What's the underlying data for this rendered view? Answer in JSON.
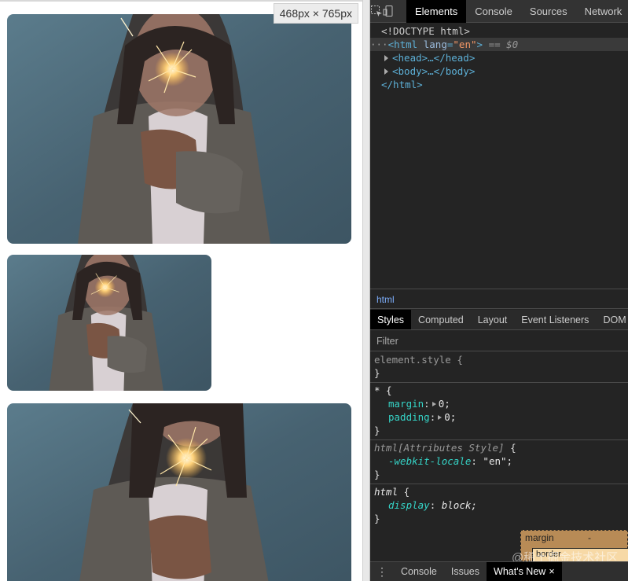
{
  "viewport": {
    "size_badge": "468px × 765px"
  },
  "devtools": {
    "tabs": [
      "Elements",
      "Console",
      "Sources",
      "Network"
    ],
    "dom": {
      "doctype": "<!DOCTYPE html>",
      "html_open_tag": "<html",
      "html_attr_name": "lang",
      "html_attr_value": "\"en\"",
      "html_close_bracket": ">",
      "selected_marker": "== $0",
      "head_node": "<head>…</head>",
      "body_node": "<body>…</body>",
      "html_close": "</html>",
      "dots": "···"
    },
    "breadcrumb": "html",
    "subtabs": [
      "Styles",
      "Computed",
      "Layout",
      "Event Listeners",
      "DOM"
    ],
    "filter_placeholder": "Filter",
    "rules": {
      "element_style": {
        "selector": "element.style {",
        "close": "}"
      },
      "universal": {
        "selector": "* {",
        "margin_prop": "margin",
        "margin_val": "0;",
        "padding_prop": "padding",
        "padding_val": "0;",
        "close": "}"
      },
      "html_attr": {
        "selector": "html[Attributes Style]",
        "brace": "{",
        "prop": "-webkit-locale",
        "val": "\"en\";",
        "close": "}"
      },
      "html": {
        "selector": "html",
        "brace": "{",
        "prop": "display",
        "val": "block;",
        "close": "}"
      }
    },
    "box_model": {
      "margin_label": "margin",
      "margin_value": "-",
      "border_label": "border"
    },
    "watermark": "@稀土掘金技术社区",
    "drawer": {
      "menu_icon": "more-vertical-icon",
      "tabs": [
        "Console",
        "Issues",
        "What's New"
      ],
      "close": "×"
    }
  }
}
